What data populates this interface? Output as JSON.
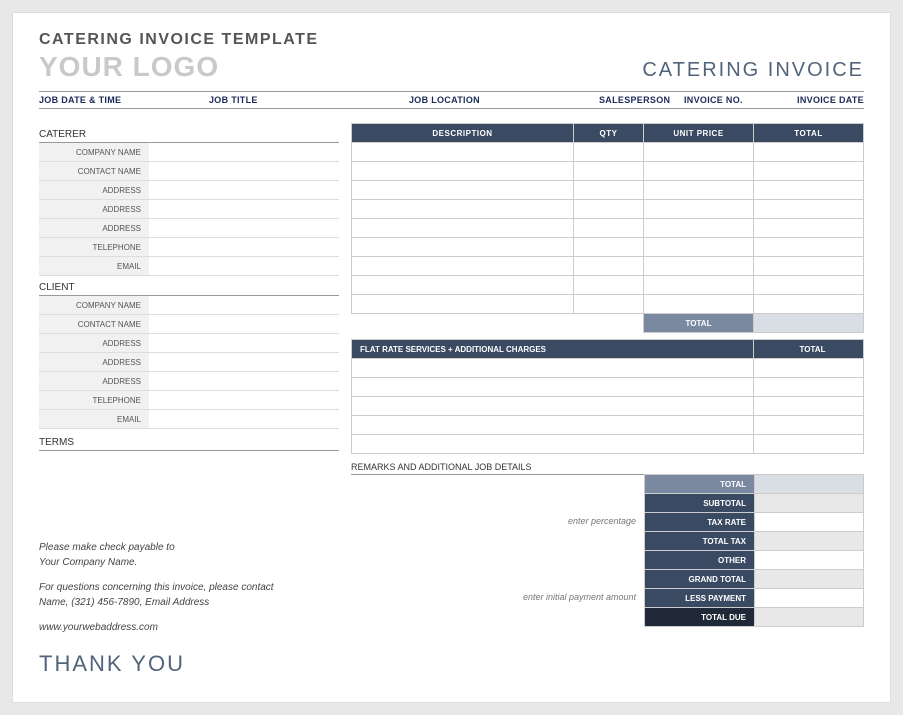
{
  "header": {
    "title": "CATERING INVOICE TEMPLATE",
    "logo_text": "YOUR LOGO",
    "doc_type": "CATERING INVOICE"
  },
  "meta": {
    "job_date_time": "JOB DATE & TIME",
    "job_title": "JOB TITLE",
    "job_location": "JOB LOCATION",
    "salesperson": "SALESPERSON",
    "invoice_no": "INVOICE NO.",
    "invoice_date": "INVOICE DATE"
  },
  "caterer": {
    "section": "CATERER",
    "labels": {
      "company_name": "COMPANY NAME",
      "contact_name": "CONTACT NAME",
      "address1": "ADDRESS",
      "address2": "ADDRESS",
      "address3": "ADDRESS",
      "telephone": "TELEPHONE",
      "email": "EMAIL"
    }
  },
  "client": {
    "section": "CLIENT",
    "labels": {
      "company_name": "COMPANY NAME",
      "contact_name": "CONTACT NAME",
      "address1": "ADDRESS",
      "address2": "ADDRESS",
      "address3": "ADDRESS",
      "telephone": "TELEPHONE",
      "email": "EMAIL"
    }
  },
  "terms_label": "TERMS",
  "items_headers": {
    "description": "DESCRIPTION",
    "qty": "QTY",
    "unit_price": "UNIT PRICE",
    "total": "TOTAL"
  },
  "items_total_label": "TOTAL",
  "flat": {
    "header": "FLAT RATE SERVICES + ADDITIONAL CHARGES",
    "total": "TOTAL"
  },
  "remarks_label": "REMARKS AND ADDITIONAL JOB DETAILS",
  "hints": {
    "percentage": "enter percentage",
    "initial_payment": "enter initial payment amount"
  },
  "totals": {
    "total": "TOTAL",
    "subtotal": "SUBTOTAL",
    "tax_rate": "TAX RATE",
    "total_tax": "TOTAL TAX",
    "other": "OTHER",
    "grand_total": "GRAND TOTAL",
    "less_payment": "LESS PAYMENT",
    "total_due": "TOTAL DUE"
  },
  "footer": {
    "payable_line1": "Please make check payable to",
    "payable_line2": "Your Company Name.",
    "questions_line1": "For questions concerning this invoice, please contact",
    "questions_line2": "Name, (321) 456-7890, Email Address",
    "website": "www.yourwebaddress.com",
    "thank_you": "THANK YOU"
  }
}
